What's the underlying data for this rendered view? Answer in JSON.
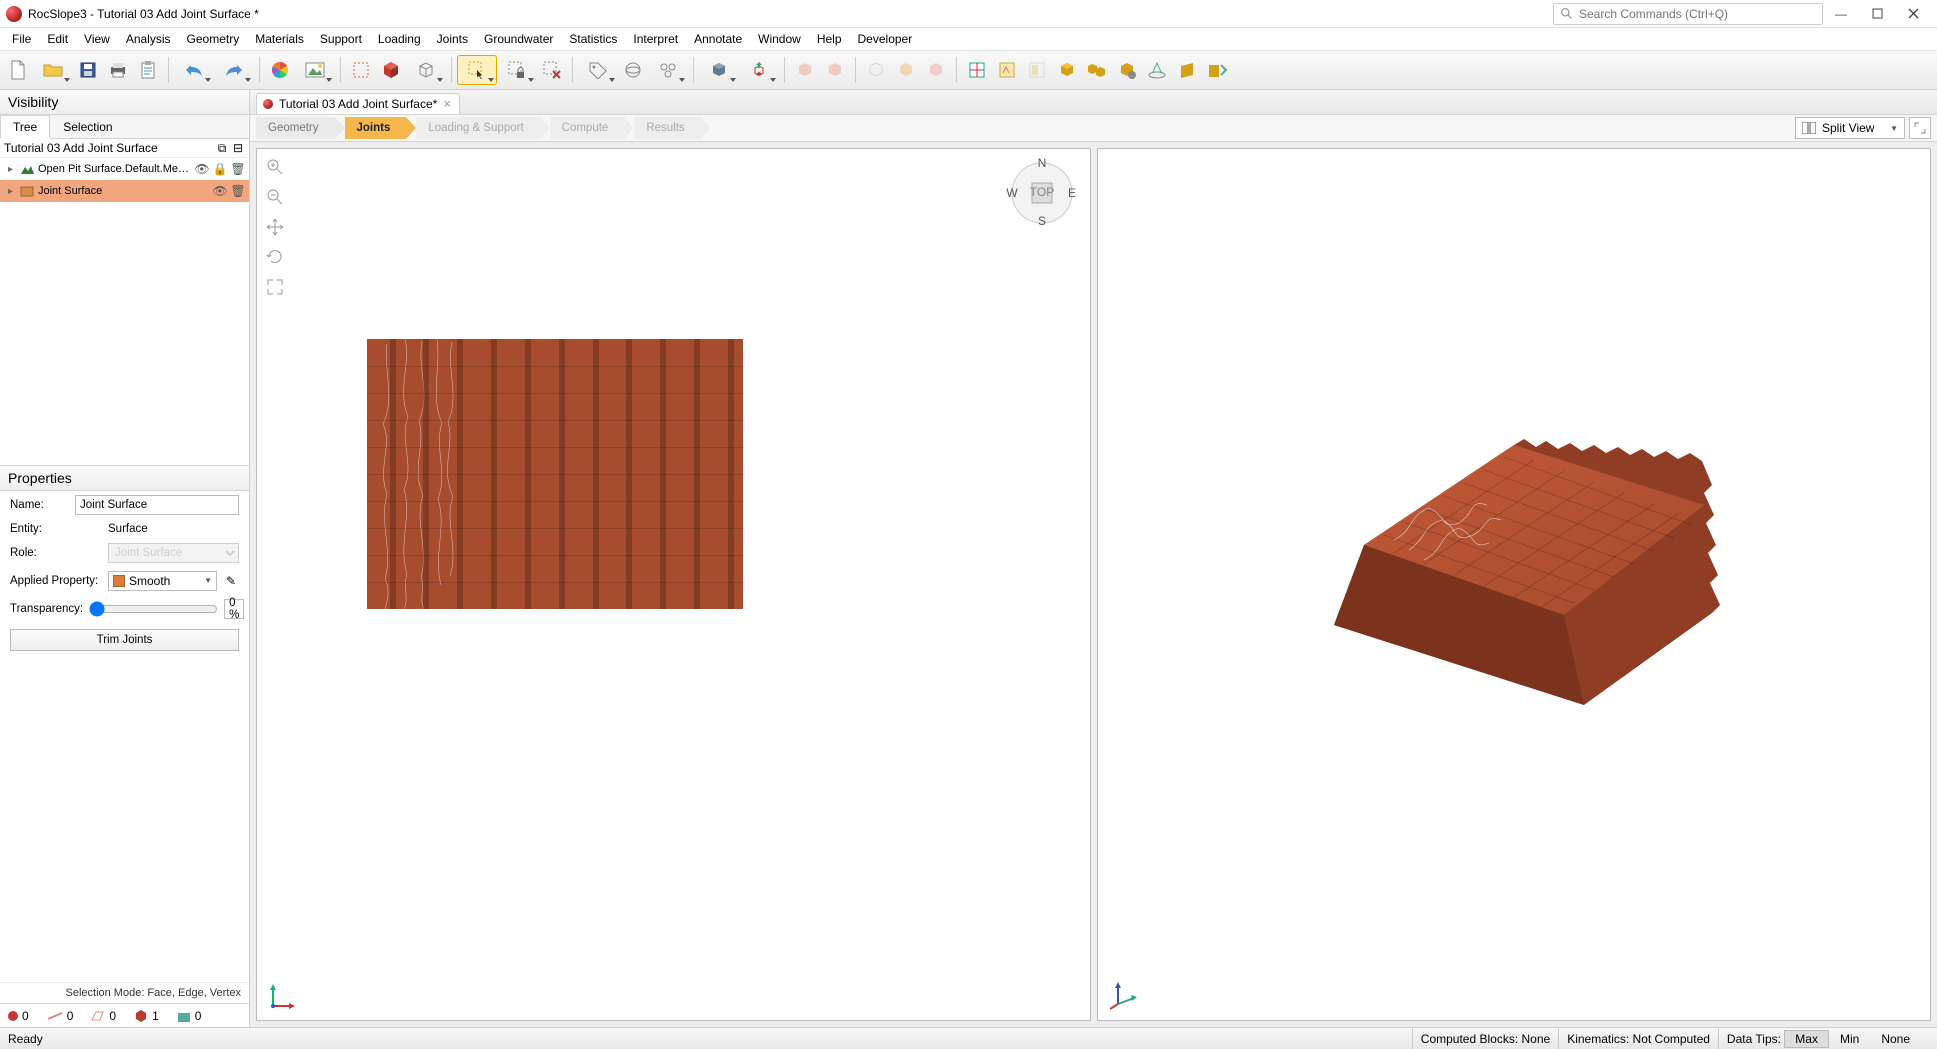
{
  "app": {
    "title": "RocSlope3 - Tutorial 03 Add Joint Surface *"
  },
  "search": {
    "placeholder": "Search Commands (Ctrl+Q)"
  },
  "menu": [
    "File",
    "Edit",
    "View",
    "Analysis",
    "Geometry",
    "Materials",
    "Support",
    "Loading",
    "Joints",
    "Groundwater",
    "Statistics",
    "Interpret",
    "Annotate",
    "Window",
    "Help",
    "Developer"
  ],
  "documentTab": {
    "label": "Tutorial 03 Add Joint Surface*"
  },
  "workflow": {
    "steps": [
      "Geometry",
      "Joints",
      "Loading & Support",
      "Compute",
      "Results"
    ],
    "activeIndex": 1
  },
  "viewMode": {
    "label": "Split View"
  },
  "visibility": {
    "title": "Visibility",
    "tabs": [
      "Tree",
      "Selection"
    ],
    "activeTab": 0,
    "rootLabel": "Tutorial 03 Add Joint Surface",
    "items": [
      {
        "label": "Open Pit Surface.Default.Mesh_ext.",
        "color": "#2e7d32",
        "selected": false
      },
      {
        "label": "Joint Surface",
        "color": "#d98b4a",
        "selected": true
      }
    ],
    "selectionMode": "Selection Mode: Face, Edge, Vertex",
    "stats": {
      "points": "0",
      "edges": "0",
      "faces": "0",
      "volumes": "1",
      "objects": "0"
    }
  },
  "properties": {
    "title": "Properties",
    "nameLabel": "Name:",
    "nameValue": "Joint Surface",
    "entityLabel": "Entity:",
    "entityValue": "Surface",
    "roleLabel": "Role:",
    "roleValue": "Joint Surface",
    "appliedLabel": "Applied Property:",
    "appliedValue": "Smooth",
    "appliedColor": "#e07b3a",
    "transparencyLabel": "Transparency:",
    "transparencyValue": "0 %",
    "trimButton": "Trim Joints"
  },
  "compass": {
    "N": "N",
    "S": "S",
    "E": "E",
    "W": "W",
    "top": "TOP"
  },
  "status": {
    "ready": "Ready",
    "computed": "Computed Blocks:  None",
    "kinematics": "Kinematics:  Not Computed",
    "datatips": "Data Tips:",
    "max": "Max",
    "min": "Min",
    "none": "None"
  }
}
